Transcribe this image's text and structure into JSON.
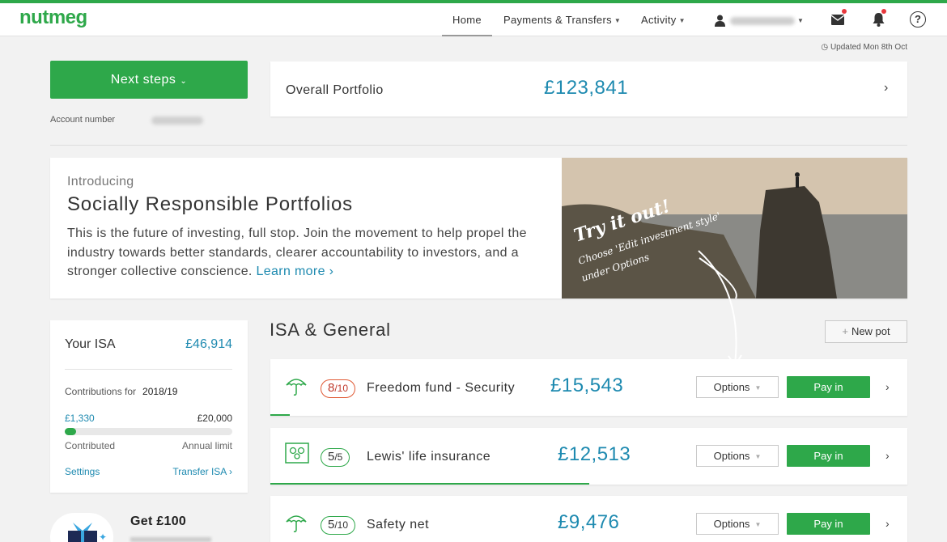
{
  "brand": {
    "logo": "nutmeg",
    "accent": "#2ea84a",
    "link": "#1e8ab0"
  },
  "nav": {
    "home": "Home",
    "payments": "Payments & Transfers",
    "activity": "Activity"
  },
  "updated": "Updated Mon 8th Oct",
  "next_steps": {
    "label": "Next steps"
  },
  "account": {
    "label": "Account number"
  },
  "overall": {
    "label": "Overall Portfolio",
    "value": "£123,841"
  },
  "promo": {
    "intro": "Introducing",
    "headline": "Socially Responsible Portfolios",
    "body": "This is the future of investing, full stop. Join the movement to help propel the industry towards better standards, clearer accountability to investors, and a stronger collective conscience. ",
    "learn_more": "Learn more",
    "image_line1": "Try it out!",
    "image_line2": "Choose 'Edit investment style'",
    "image_line3": "under Options"
  },
  "isa": {
    "title": "Your ISA",
    "value": "£46,914",
    "contrib_label": "Contributions for",
    "year": "2018/19",
    "contributed": "£1,330",
    "limit": "£20,000",
    "contributed_fraction": 0.0665,
    "contributed_label": "Contributed",
    "limit_label": "Annual limit",
    "settings": "Settings",
    "transfer": "Transfer ISA"
  },
  "referral": {
    "title": "Get £100"
  },
  "section": {
    "title": "ISA & General",
    "new_pot": "New pot"
  },
  "pots": [
    {
      "risk": "8",
      "risk_max": "/10",
      "name": "Freedom fund - Security",
      "value": "£15,543",
      "options": "Options",
      "payin": "Pay in",
      "icon": "umbrella-icon",
      "progress": 0.03
    },
    {
      "risk": "5",
      "risk_max": "/5",
      "name": "Lewis' life insurance",
      "value": "£12,513",
      "options": "Options",
      "payin": "Pay in",
      "icon": "family-photo-icon",
      "progress": 0.5
    },
    {
      "risk": "5",
      "risk_max": "/10",
      "name": "Safety net",
      "value": "£9,476",
      "options": "Options",
      "payin": "Pay in",
      "icon": "umbrella-icon",
      "progress": 0
    }
  ]
}
